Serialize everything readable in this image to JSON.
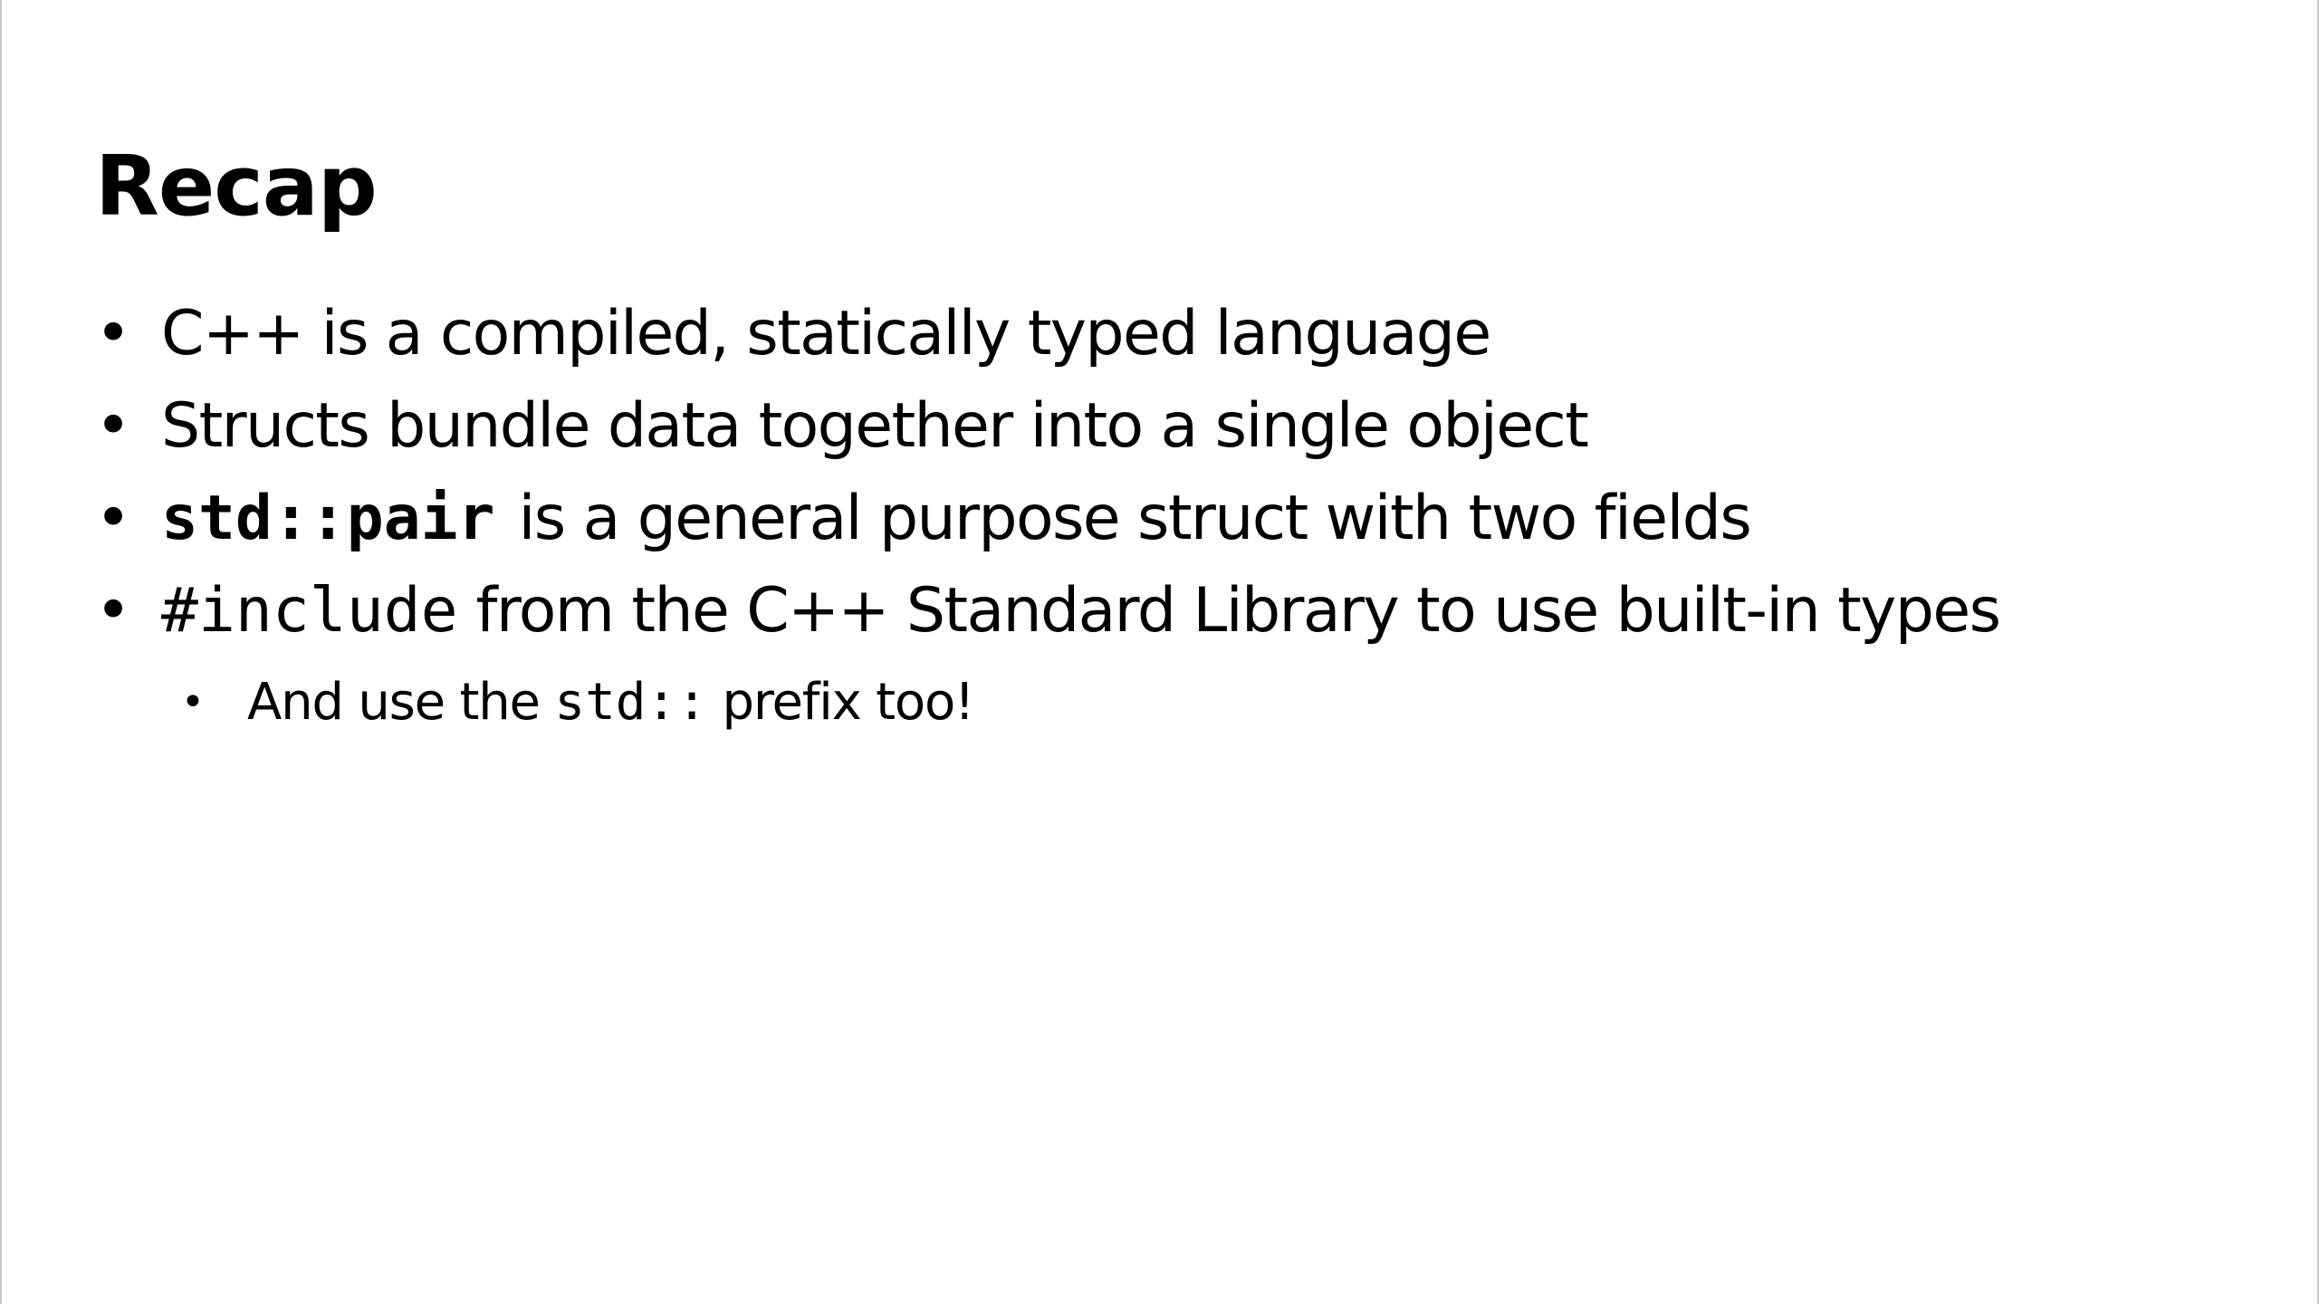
{
  "slide": {
    "title": "Recap",
    "bullets": [
      {
        "text": "C++ is a compiled, statically typed language"
      },
      {
        "text": "Structs bundle data together into a single object"
      },
      {
        "code": "std::pair",
        "text": "is a general purpose struct with two fields"
      },
      {
        "code": "#include",
        "text": " from the C++ Standard Library to use built-in types"
      }
    ],
    "sub_bullet": {
      "before": "And use the ",
      "code": "std::",
      "after": " prefix too!"
    }
  }
}
